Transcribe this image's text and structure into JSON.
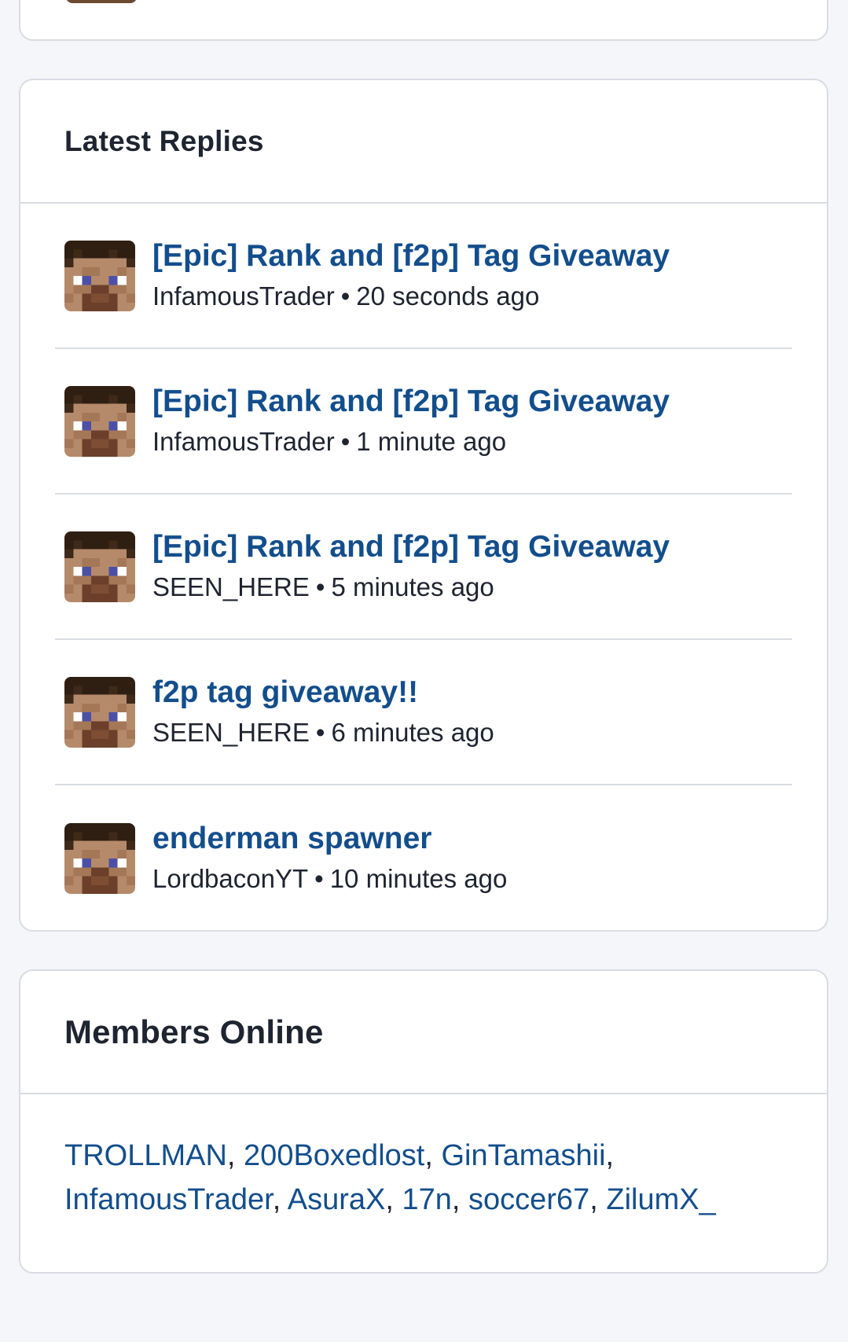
{
  "latest_replies": {
    "title": "Latest Replies",
    "items": [
      {
        "title": "[Epic] Rank and [f2p] Tag Giveaway",
        "author": "InfamousTrader",
        "time": "20 seconds ago"
      },
      {
        "title": "[Epic] Rank and [f2p] Tag Giveaway",
        "author": "InfamousTrader",
        "time": "1 minute ago"
      },
      {
        "title": "[Epic] Rank and [f2p] Tag Giveaway",
        "author": "SEEN_HERE",
        "time": "5 minutes ago"
      },
      {
        "title": "f2p tag giveaway!!",
        "author": "SEEN_HERE",
        "time": "6 minutes ago"
      },
      {
        "title": "enderman spawner",
        "author": "LordbaconYT",
        "time": "10 minutes ago"
      }
    ]
  },
  "members_online": {
    "title": "Members Online",
    "members": [
      "TROLLMAN",
      "200Boxedlost",
      "GinTamashii",
      "InfamousTrader",
      "AsuraX",
      "17n",
      "soccer67",
      "ZilumX_"
    ]
  },
  "meta_separator": "•",
  "list_separator": ",",
  "colors": {
    "link": "#134e8c",
    "text": "#1e2430",
    "border": "#d8dce3",
    "background": "#f5f6fa"
  }
}
